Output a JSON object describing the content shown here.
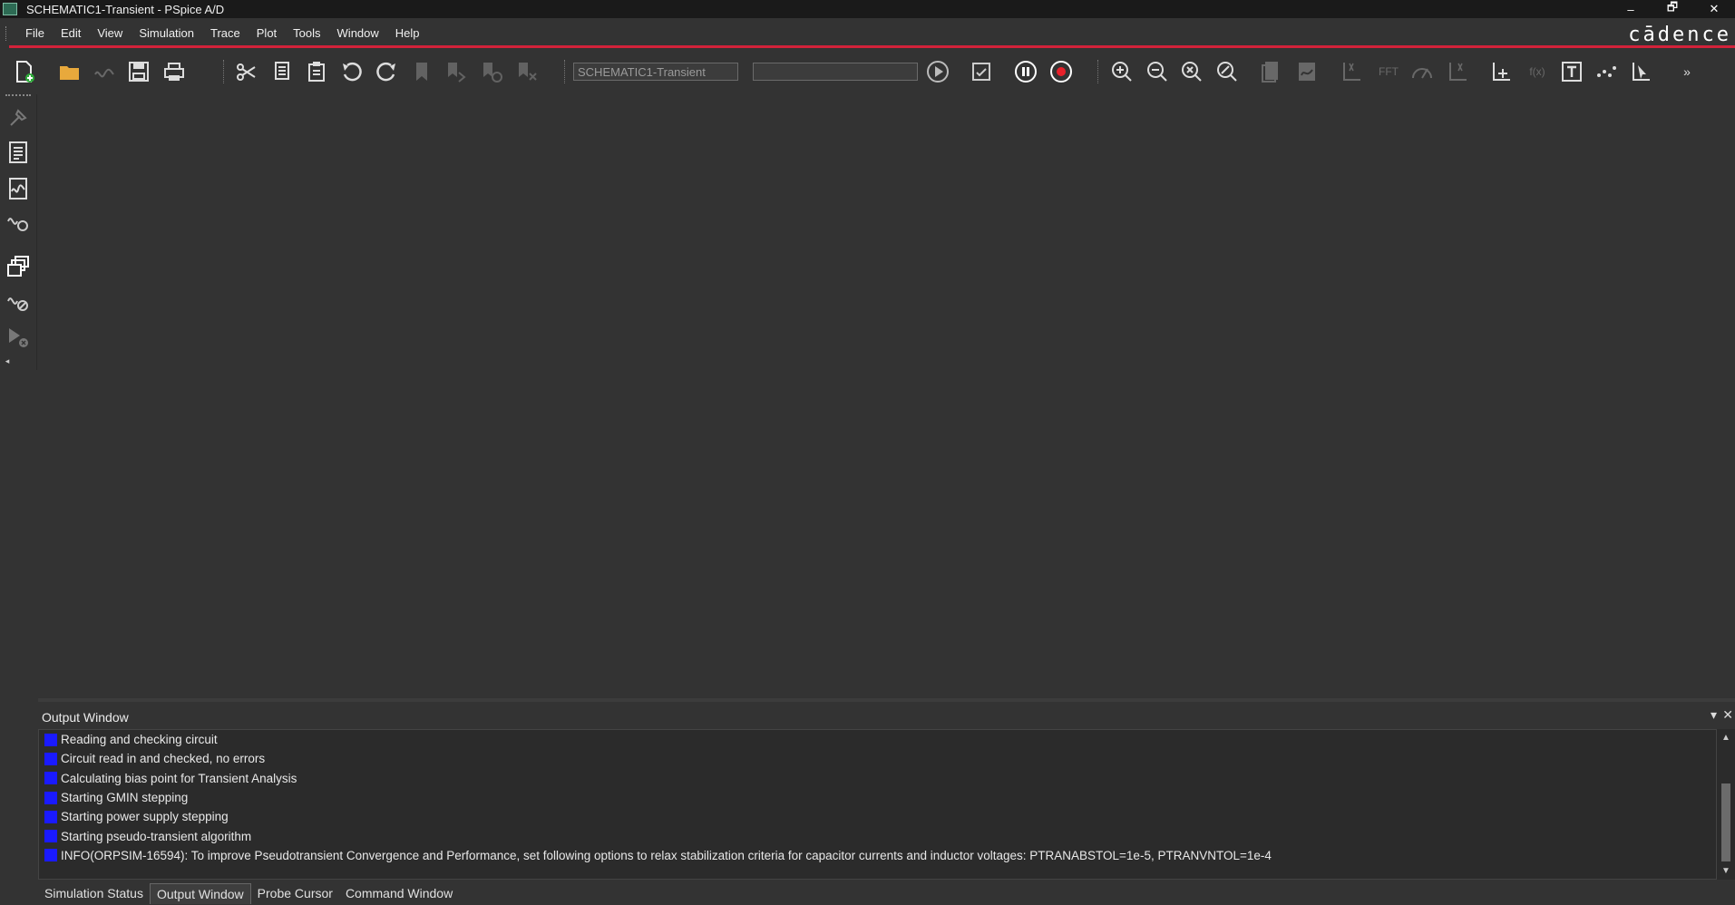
{
  "window": {
    "title": "SCHEMATIC1-Transient - PSpice A/D",
    "controls": [
      "–",
      "🗗",
      "✕"
    ]
  },
  "menu": [
    "File",
    "Edit",
    "View",
    "Simulation",
    "Trace",
    "Plot",
    "Tools",
    "Window",
    "Help"
  ],
  "brand": {
    "logo": "cādence",
    "color": "#d3223a"
  },
  "toolbar": {
    "profile": "SCHEMATIC1-Transient",
    "fft_label": "FFT",
    "fx_label": "f(x)"
  },
  "output_window": {
    "title": "Output Window",
    "lines": [
      "Reading and checking circuit",
      "Circuit read in and checked, no errors",
      "Calculating bias point for Transient Analysis",
      "Starting GMIN stepping",
      "Starting power supply stepping",
      "Starting pseudo-transient algorithm",
      "INFO(ORPSIM-16594): To improve Pseudotransient Convergence and Performance, set following options to relax stabilization criteria for capacitor currents and inductor voltages: PTRANABSTOL=1e-5, PTRANVNTOL=1e-4"
    ],
    "message_color": "#1a1aff"
  },
  "tabs": [
    "Simulation Status",
    "Output Window",
    "Probe Cursor",
    "Command Window"
  ],
  "active_tab": "Output Window"
}
